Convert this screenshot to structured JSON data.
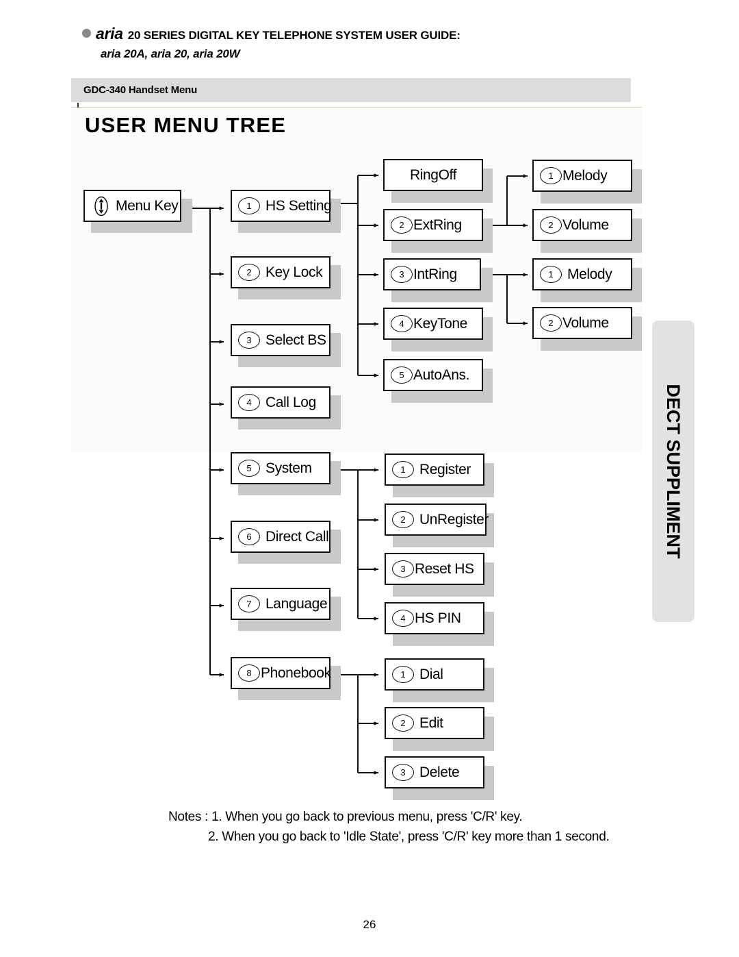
{
  "header": {
    "bullet_icon": "bullet-dot-icon",
    "brand": "aria",
    "title_rest": "20 SERIES DIGITAL KEY TELEPHONE SYSTEM  USER GUIDE:",
    "models": "aria 20A, aria 20, aria 20W"
  },
  "section_band": {
    "label": "GDC-340 Handset Menu",
    "background": "#dcdcdc"
  },
  "side_tab": {
    "label": "DECT SUPPLIMENT",
    "background": "#e2e2e2"
  },
  "tree_title": "USER MENU TREE",
  "notes": {
    "note_1": "Notes : 1. When you go back to previous menu, press  'C/R' key.",
    "note_2": "2. When you go back to 'Idle State', press 'C/R' key more than 1 second."
  },
  "page_number": "26",
  "colors": {
    "box_border": "#111111",
    "box_fill": "#ffffff",
    "shadow": "#c9c9c9",
    "rule": "#d8cfb0"
  },
  "chart_data": {
    "type": "tree",
    "title": "USER MENU TREE",
    "root": {
      "id": "menu-key",
      "num": "",
      "label": "Menu Key",
      "icon": "updown-rocker-icon"
    },
    "nodes": [
      {
        "id": "hs-setting",
        "num": "1",
        "label": "HS Setting",
        "level": 1,
        "parent": "menu-key"
      },
      {
        "id": "key-lock",
        "num": "2",
        "label": "Key Lock",
        "level": 1,
        "parent": "menu-key"
      },
      {
        "id": "select-bs",
        "num": "3",
        "label": "Select BS",
        "level": 1,
        "parent": "menu-key"
      },
      {
        "id": "call-log",
        "num": "4",
        "label": "Call Log",
        "level": 1,
        "parent": "menu-key"
      },
      {
        "id": "system",
        "num": "5",
        "label": "System",
        "level": 1,
        "parent": "menu-key"
      },
      {
        "id": "direct-call",
        "num": "6",
        "label": "Direct Call",
        "level": 1,
        "parent": "menu-key"
      },
      {
        "id": "language",
        "num": "7",
        "label": "Language",
        "level": 1,
        "parent": "menu-key"
      },
      {
        "id": "phonebook",
        "num": "8",
        "label": "Phonebook",
        "level": 1,
        "parent": "menu-key"
      },
      {
        "id": "ringoff",
        "num": "",
        "label": "RingOff",
        "level": 2,
        "parent": "hs-setting"
      },
      {
        "id": "extring",
        "num": "2",
        "label": "ExtRing",
        "level": 2,
        "parent": "hs-setting"
      },
      {
        "id": "intring",
        "num": "3",
        "label": "IntRing",
        "level": 2,
        "parent": "hs-setting"
      },
      {
        "id": "keytone",
        "num": "4",
        "label": "KeyTone",
        "level": 2,
        "parent": "hs-setting"
      },
      {
        "id": "autoans",
        "num": "5",
        "label": "AutoAns.",
        "level": 2,
        "parent": "hs-setting"
      },
      {
        "id": "ext-melody",
        "num": "1",
        "label": "Melody",
        "level": 3,
        "parent": "extring"
      },
      {
        "id": "ext-volume",
        "num": "2",
        "label": "Volume",
        "level": 3,
        "parent": "extring"
      },
      {
        "id": "int-melody",
        "num": "1",
        "label": "Melody",
        "level": 3,
        "parent": "intring"
      },
      {
        "id": "int-volume",
        "num": "2",
        "label": "Volume",
        "level": 3,
        "parent": "intring"
      },
      {
        "id": "register",
        "num": "1",
        "label": "Register",
        "level": 2,
        "parent": "system"
      },
      {
        "id": "unregister",
        "num": "2",
        "label": "UnRegister",
        "level": 2,
        "parent": "system"
      },
      {
        "id": "reset-hs",
        "num": "3",
        "label": "Reset HS",
        "level": 2,
        "parent": "system"
      },
      {
        "id": "hs-pin",
        "num": "4",
        "label": "HS PIN",
        "level": 2,
        "parent": "system"
      },
      {
        "id": "dial",
        "num": "1",
        "label": "Dial",
        "level": 2,
        "parent": "phonebook"
      },
      {
        "id": "edit",
        "num": "2",
        "label": "Edit",
        "level": 2,
        "parent": "phonebook"
      },
      {
        "id": "delete",
        "num": "3",
        "label": "Delete",
        "level": 2,
        "parent": "phonebook"
      }
    ]
  }
}
